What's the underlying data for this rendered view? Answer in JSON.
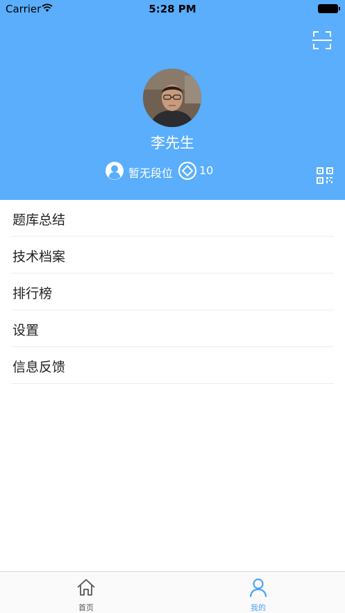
{
  "status_bar": {
    "carrier": "Carrier",
    "time": "5:28 PM"
  },
  "header": {
    "background_color": "#5aaefc",
    "username": "李先生",
    "rank": "暂无段位",
    "coins": "10",
    "icons": [
      "scan-icon",
      "qr-code-icon",
      "rank-user-icon",
      "coin-icon"
    ]
  },
  "menu": {
    "items": [
      {
        "label": "题库总结"
      },
      {
        "label": "技术档案"
      },
      {
        "label": "排行榜"
      },
      {
        "label": "设置"
      },
      {
        "label": "信息反馈"
      }
    ]
  },
  "tabbar": {
    "home_label": "首页",
    "mine_label": "我的",
    "active_tab": "我的",
    "active_color": "#4aa3f5"
  }
}
